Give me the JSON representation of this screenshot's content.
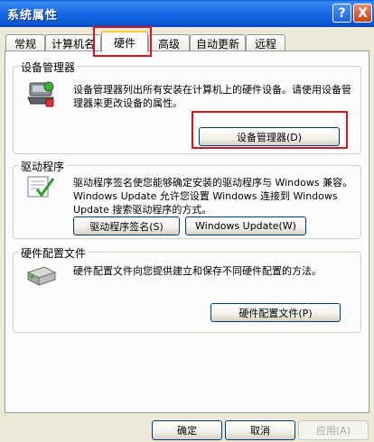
{
  "window": {
    "title": "系统属性"
  },
  "titlebar": {
    "help_glyph": "?",
    "close_glyph": "X"
  },
  "tabs": [
    "常规",
    "计算机名",
    "硬件",
    "高级",
    "自动更新",
    "远程"
  ],
  "sections": {
    "device_manager": {
      "legend": "设备管理器",
      "description": "设备管理器列出所有安装在计算机上的硬件设备。请使用设备管理器来更改设备的属性。",
      "button": "设备管理器(D)"
    },
    "drivers": {
      "legend": "驱动程序",
      "description": "驱动程序签名使您能够确定安装的驱动程序与 Windows 兼容。Windows Update 允许您设置 Windows 连接到 Windows Update 搜索驱动程序的方式。",
      "signing_button": "驱动程序签名(S)",
      "update_button": "Windows Update(W)"
    },
    "hardware_profiles": {
      "legend": "硬件配置文件",
      "description": "硬件配置文件向您提供建立和保存不同硬件配置的方法。",
      "button": "硬件配置文件(P)"
    }
  },
  "footer": {
    "ok": "确定",
    "cancel": "取消",
    "apply": "应用(A)"
  },
  "colors": {
    "highlight": "#d8141c",
    "titlebar": "#0b56d6"
  }
}
